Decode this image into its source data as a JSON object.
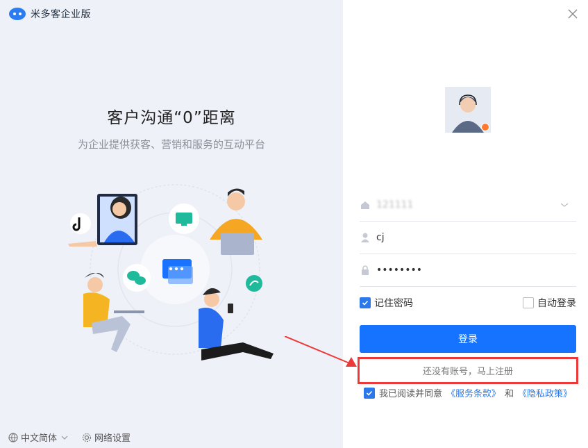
{
  "brand": {
    "name": "米多客企业版"
  },
  "hero": {
    "headline": "客户沟通“0”距离",
    "subline": "为企业提供获客、营销和服务的互动平台"
  },
  "footer": {
    "language": "中文简体",
    "network": "网络设置"
  },
  "form": {
    "company_value": "121111",
    "username_value": "cj",
    "password_value": "••••••••",
    "remember_label": "记住密码",
    "remember_checked": true,
    "autologin_label": "自动登录",
    "autologin_checked": false,
    "login_label": "登录",
    "register_label": "还没有账号，马上注册",
    "agree_prefix": "我已阅读并同意",
    "terms_label": "《服务条款》",
    "and_label": "和",
    "privacy_label": "《隐私政策》",
    "agree_checked": true
  },
  "colors": {
    "primary": "#1673ff",
    "highlight": "#ec3a3a",
    "left_bg": "#eff1f8"
  },
  "icons": [
    "brand-logo-icon",
    "tiktok-icon",
    "chat-monitor-icon",
    "wechat-icon",
    "chat-bubble-icon",
    "miniprogram-icon",
    "close-icon",
    "home-icon",
    "user-icon",
    "lock-icon",
    "chevron-down-icon",
    "globe-icon",
    "gear-icon",
    "check-icon"
  ]
}
